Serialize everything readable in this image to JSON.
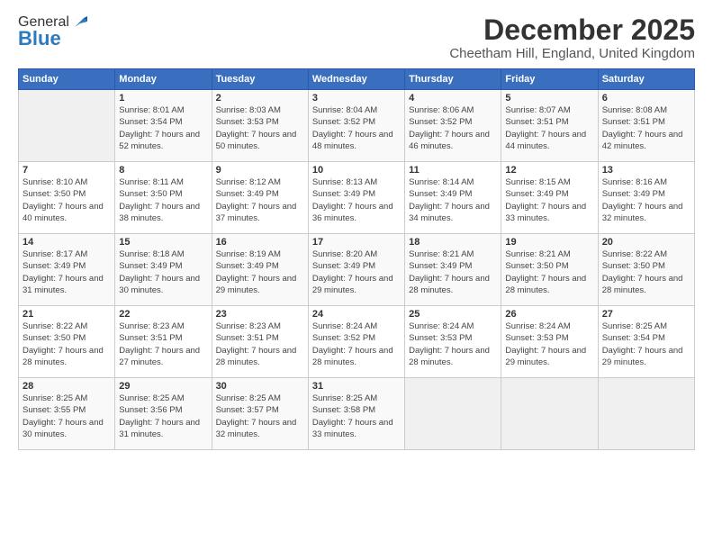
{
  "logo": {
    "general": "General",
    "blue": "Blue"
  },
  "title": {
    "month_year": "December 2025",
    "location": "Cheetham Hill, England, United Kingdom"
  },
  "weekdays": [
    "Sunday",
    "Monday",
    "Tuesday",
    "Wednesday",
    "Thursday",
    "Friday",
    "Saturday"
  ],
  "weeks": [
    [
      {
        "day": "",
        "sunrise": "",
        "sunset": "",
        "daylight": ""
      },
      {
        "day": "1",
        "sunrise": "Sunrise: 8:01 AM",
        "sunset": "Sunset: 3:54 PM",
        "daylight": "Daylight: 7 hours and 52 minutes."
      },
      {
        "day": "2",
        "sunrise": "Sunrise: 8:03 AM",
        "sunset": "Sunset: 3:53 PM",
        "daylight": "Daylight: 7 hours and 50 minutes."
      },
      {
        "day": "3",
        "sunrise": "Sunrise: 8:04 AM",
        "sunset": "Sunset: 3:52 PM",
        "daylight": "Daylight: 7 hours and 48 minutes."
      },
      {
        "day": "4",
        "sunrise": "Sunrise: 8:06 AM",
        "sunset": "Sunset: 3:52 PM",
        "daylight": "Daylight: 7 hours and 46 minutes."
      },
      {
        "day": "5",
        "sunrise": "Sunrise: 8:07 AM",
        "sunset": "Sunset: 3:51 PM",
        "daylight": "Daylight: 7 hours and 44 minutes."
      },
      {
        "day": "6",
        "sunrise": "Sunrise: 8:08 AM",
        "sunset": "Sunset: 3:51 PM",
        "daylight": "Daylight: 7 hours and 42 minutes."
      }
    ],
    [
      {
        "day": "7",
        "sunrise": "Sunrise: 8:10 AM",
        "sunset": "Sunset: 3:50 PM",
        "daylight": "Daylight: 7 hours and 40 minutes."
      },
      {
        "day": "8",
        "sunrise": "Sunrise: 8:11 AM",
        "sunset": "Sunset: 3:50 PM",
        "daylight": "Daylight: 7 hours and 38 minutes."
      },
      {
        "day": "9",
        "sunrise": "Sunrise: 8:12 AM",
        "sunset": "Sunset: 3:49 PM",
        "daylight": "Daylight: 7 hours and 37 minutes."
      },
      {
        "day": "10",
        "sunrise": "Sunrise: 8:13 AM",
        "sunset": "Sunset: 3:49 PM",
        "daylight": "Daylight: 7 hours and 36 minutes."
      },
      {
        "day": "11",
        "sunrise": "Sunrise: 8:14 AM",
        "sunset": "Sunset: 3:49 PM",
        "daylight": "Daylight: 7 hours and 34 minutes."
      },
      {
        "day": "12",
        "sunrise": "Sunrise: 8:15 AM",
        "sunset": "Sunset: 3:49 PM",
        "daylight": "Daylight: 7 hours and 33 minutes."
      },
      {
        "day": "13",
        "sunrise": "Sunrise: 8:16 AM",
        "sunset": "Sunset: 3:49 PM",
        "daylight": "Daylight: 7 hours and 32 minutes."
      }
    ],
    [
      {
        "day": "14",
        "sunrise": "Sunrise: 8:17 AM",
        "sunset": "Sunset: 3:49 PM",
        "daylight": "Daylight: 7 hours and 31 minutes."
      },
      {
        "day": "15",
        "sunrise": "Sunrise: 8:18 AM",
        "sunset": "Sunset: 3:49 PM",
        "daylight": "Daylight: 7 hours and 30 minutes."
      },
      {
        "day": "16",
        "sunrise": "Sunrise: 8:19 AM",
        "sunset": "Sunset: 3:49 PM",
        "daylight": "Daylight: 7 hours and 29 minutes."
      },
      {
        "day": "17",
        "sunrise": "Sunrise: 8:20 AM",
        "sunset": "Sunset: 3:49 PM",
        "daylight": "Daylight: 7 hours and 29 minutes."
      },
      {
        "day": "18",
        "sunrise": "Sunrise: 8:21 AM",
        "sunset": "Sunset: 3:49 PM",
        "daylight": "Daylight: 7 hours and 28 minutes."
      },
      {
        "day": "19",
        "sunrise": "Sunrise: 8:21 AM",
        "sunset": "Sunset: 3:50 PM",
        "daylight": "Daylight: 7 hours and 28 minutes."
      },
      {
        "day": "20",
        "sunrise": "Sunrise: 8:22 AM",
        "sunset": "Sunset: 3:50 PM",
        "daylight": "Daylight: 7 hours and 28 minutes."
      }
    ],
    [
      {
        "day": "21",
        "sunrise": "Sunrise: 8:22 AM",
        "sunset": "Sunset: 3:50 PM",
        "daylight": "Daylight: 7 hours and 28 minutes."
      },
      {
        "day": "22",
        "sunrise": "Sunrise: 8:23 AM",
        "sunset": "Sunset: 3:51 PM",
        "daylight": "Daylight: 7 hours and 27 minutes."
      },
      {
        "day": "23",
        "sunrise": "Sunrise: 8:23 AM",
        "sunset": "Sunset: 3:51 PM",
        "daylight": "Daylight: 7 hours and 28 minutes."
      },
      {
        "day": "24",
        "sunrise": "Sunrise: 8:24 AM",
        "sunset": "Sunset: 3:52 PM",
        "daylight": "Daylight: 7 hours and 28 minutes."
      },
      {
        "day": "25",
        "sunrise": "Sunrise: 8:24 AM",
        "sunset": "Sunset: 3:53 PM",
        "daylight": "Daylight: 7 hours and 28 minutes."
      },
      {
        "day": "26",
        "sunrise": "Sunrise: 8:24 AM",
        "sunset": "Sunset: 3:53 PM",
        "daylight": "Daylight: 7 hours and 29 minutes."
      },
      {
        "day": "27",
        "sunrise": "Sunrise: 8:25 AM",
        "sunset": "Sunset: 3:54 PM",
        "daylight": "Daylight: 7 hours and 29 minutes."
      }
    ],
    [
      {
        "day": "28",
        "sunrise": "Sunrise: 8:25 AM",
        "sunset": "Sunset: 3:55 PM",
        "daylight": "Daylight: 7 hours and 30 minutes."
      },
      {
        "day": "29",
        "sunrise": "Sunrise: 8:25 AM",
        "sunset": "Sunset: 3:56 PM",
        "daylight": "Daylight: 7 hours and 31 minutes."
      },
      {
        "day": "30",
        "sunrise": "Sunrise: 8:25 AM",
        "sunset": "Sunset: 3:57 PM",
        "daylight": "Daylight: 7 hours and 32 minutes."
      },
      {
        "day": "31",
        "sunrise": "Sunrise: 8:25 AM",
        "sunset": "Sunset: 3:58 PM",
        "daylight": "Daylight: 7 hours and 33 minutes."
      },
      {
        "day": "",
        "sunrise": "",
        "sunset": "",
        "daylight": ""
      },
      {
        "day": "",
        "sunrise": "",
        "sunset": "",
        "daylight": ""
      },
      {
        "day": "",
        "sunrise": "",
        "sunset": "",
        "daylight": ""
      }
    ]
  ]
}
